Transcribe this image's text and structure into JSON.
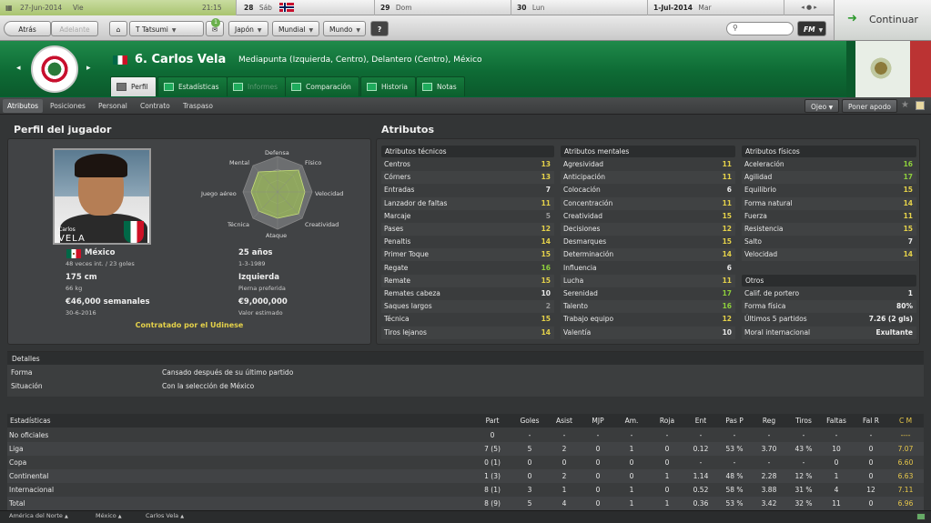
{
  "calendar": {
    "date": "27-Jun-2014",
    "weekday": "Vie",
    "time": "21:15",
    "days": [
      {
        "num": "28",
        "label": "Sáb"
      },
      {
        "num": "29",
        "label": "Dom"
      },
      {
        "num": "30",
        "label": "Lun"
      },
      {
        "num": "1-Jul-2014",
        "label": "Mar"
      }
    ],
    "nav": "◂ ● ▸"
  },
  "toolbar": {
    "back": "Atrás",
    "forward": "Adelante",
    "manager": "T Tatsumi",
    "notification_count": "1",
    "menus": [
      "Japón",
      "Mundial",
      "Mundo"
    ],
    "help": "?",
    "search_placeholder": "",
    "fm_menu": "FM",
    "continue": "Continuar"
  },
  "header": {
    "number_name": "6. Carlos Vela",
    "positions": "Mediapunta (Izquierda, Centro), Delantero (Centro), México"
  },
  "tabs": [
    "Perfil",
    "Estadísticas",
    "Informes",
    "Comparación",
    "Historia",
    "Notas"
  ],
  "subtabs": [
    "Atributos",
    "Posiciones",
    "Personal",
    "Contrato",
    "Traspaso"
  ],
  "right_buttons": {
    "ojeo": "Ojeo",
    "apodo": "Poner apodo"
  },
  "profile": {
    "title": "Perfil del jugador",
    "photo_caption_small": "Carlos",
    "photo_caption_big": "VELA",
    "nation": "México",
    "caps": "48 veces int. / 23 goles",
    "age": "25 años",
    "dob": "1-3-1989",
    "height": "175 cm",
    "weight": "66 kg",
    "foot": "Izquierda",
    "foot_label": "Pierna preferida",
    "wage": "€46,000 semanales",
    "contract_end": "30-6-2016",
    "value": "€9,000,000",
    "value_label": "Valor estimado",
    "contract_status": "Contratado por el Udinese",
    "radar_labels": {
      "defensa": "Defensa",
      "fisico": "Físico",
      "velocidad": "Velocidad",
      "creatividad": "Creatividad",
      "ataque": "Ataque",
      "tecnica": "Técnica",
      "juego_aereo": "Juego aéreo",
      "mental": "Mental"
    }
  },
  "attributes": {
    "title": "Atributos",
    "colors": {
      "high": "#e5d24a",
      "good": "#8ecf3c",
      "mid": "#e8e8e8",
      "low": "#9a9a9a"
    },
    "tecnicos": {
      "title": "Atributos técnicos",
      "rows": [
        {
          "name": "Centros",
          "value": "13"
        },
        {
          "name": "Córners",
          "value": "13"
        },
        {
          "name": "Entradas",
          "value": "7"
        },
        {
          "name": "Lanzador de faltas",
          "value": "11"
        },
        {
          "name": "Marcaje",
          "value": "5"
        },
        {
          "name": "Pases",
          "value": "12"
        },
        {
          "name": "Penaltis",
          "value": "14"
        },
        {
          "name": "Primer Toque",
          "value": "15"
        },
        {
          "name": "Regate",
          "value": "16"
        },
        {
          "name": "Remate",
          "value": "15"
        },
        {
          "name": "Remates cabeza",
          "value": "10"
        },
        {
          "name": "Saques largos",
          "value": "2"
        },
        {
          "name": "Técnica",
          "value": "15"
        },
        {
          "name": "Tiros lejanos",
          "value": "14"
        }
      ]
    },
    "mentales": {
      "title": "Atributos mentales",
      "rows": [
        {
          "name": "Agresividad",
          "value": "11"
        },
        {
          "name": "Anticipación",
          "value": "11"
        },
        {
          "name": "Colocación",
          "value": "6"
        },
        {
          "name": "Concentración",
          "value": "11"
        },
        {
          "name": "Creatividad",
          "value": "15"
        },
        {
          "name": "Decisiones",
          "value": "12"
        },
        {
          "name": "Desmarques",
          "value": "15"
        },
        {
          "name": "Determinación",
          "value": "14"
        },
        {
          "name": "Influencia",
          "value": "6"
        },
        {
          "name": "Lucha",
          "value": "11"
        },
        {
          "name": "Serenidad",
          "value": "17"
        },
        {
          "name": "Talento",
          "value": "16"
        },
        {
          "name": "Trabajo equipo",
          "value": "12"
        },
        {
          "name": "Valentía",
          "value": "10"
        }
      ]
    },
    "fisicos": {
      "title": "Atributos físicos",
      "rows": [
        {
          "name": "Aceleración",
          "value": "16"
        },
        {
          "name": "Agilidad",
          "value": "17"
        },
        {
          "name": "Equilibrio",
          "value": "15"
        },
        {
          "name": "Forma natural",
          "value": "14"
        },
        {
          "name": "Fuerza",
          "value": "11"
        },
        {
          "name": "Resistencia",
          "value": "15"
        },
        {
          "name": "Salto",
          "value": "7"
        },
        {
          "name": "Velocidad",
          "value": "14"
        }
      ]
    },
    "otros": {
      "title": "Otros",
      "rows": [
        {
          "name": "Calif. de portero",
          "value": "1"
        },
        {
          "name": "Forma física",
          "value": "80%"
        },
        {
          "name": "Últimos 5 partidos",
          "value": "7.26 (2 gls)"
        },
        {
          "name": "Moral internacional",
          "value": "Exultante"
        }
      ]
    }
  },
  "details": {
    "title": "Detalles",
    "rows": [
      {
        "label": "Forma",
        "value": "Cansado después de su último partido"
      },
      {
        "label": "Situación",
        "value": "Con la selección de México"
      }
    ]
  },
  "stats": {
    "title": "Estadísticas",
    "columns": [
      "Part",
      "Goles",
      "Asist",
      "MJP",
      "Am.",
      "Roja",
      "Ent",
      "Pas P",
      "Reg",
      "Tiros",
      "Faltas",
      "Fal R",
      "C M"
    ],
    "rows": [
      {
        "label": "No oficiales",
        "cells": [
          "0",
          "-",
          "-",
          "-",
          "-",
          "-",
          "-",
          "-",
          "-",
          "-",
          "-",
          "-",
          "----"
        ]
      },
      {
        "label": "Liga",
        "cells": [
          "7 (5)",
          "5",
          "2",
          "0",
          "1",
          "0",
          "0.12",
          "53 %",
          "3.70",
          "43 %",
          "10",
          "0",
          "7.07"
        ]
      },
      {
        "label": "Copa",
        "cells": [
          "0 (1)",
          "0",
          "0",
          "0",
          "0",
          "0",
          "-",
          "-",
          "-",
          "-",
          "0",
          "0",
          "6.60"
        ]
      },
      {
        "label": "Continental",
        "cells": [
          "1 (3)",
          "0",
          "2",
          "0",
          "0",
          "1",
          "1.14",
          "48 %",
          "2.28",
          "12 %",
          "1",
          "0",
          "6.63"
        ]
      },
      {
        "label": "Internacional",
        "cells": [
          "8 (1)",
          "3",
          "1",
          "0",
          "1",
          "0",
          "0.52",
          "58 %",
          "3.88",
          "31 %",
          "4",
          "12",
          "7.11"
        ]
      },
      {
        "label": "Total",
        "cells": [
          "8 (9)",
          "5",
          "4",
          "0",
          "1",
          "1",
          "0.36",
          "53 %",
          "3.42",
          "32 %",
          "11",
          "0",
          "6.96"
        ]
      }
    ]
  },
  "breadcrumb": [
    "América del Norte",
    "México",
    "Carlos Vela"
  ]
}
